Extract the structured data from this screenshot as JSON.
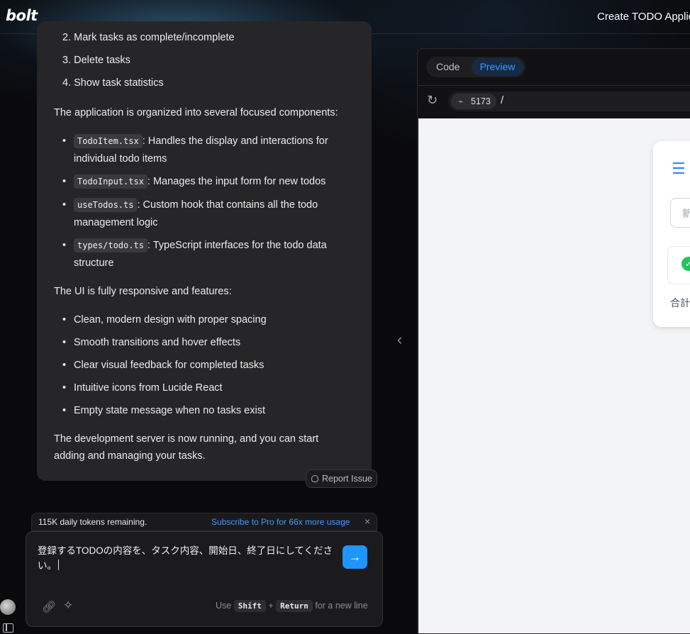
{
  "header": {
    "logo": "bolt",
    "project_title": "Create TODO Applic"
  },
  "message": {
    "ol": [
      {
        "num": "2.",
        "text": "Mark tasks as complete/incomplete"
      },
      {
        "num": "3.",
        "text": "Delete tasks"
      },
      {
        "num": "4.",
        "text": "Show task statistics"
      }
    ],
    "intro": "The application is organized into several focused components:",
    "components": [
      {
        "code": "TodoItem.tsx",
        "text": ": Handles the display and interactions for individual todo items"
      },
      {
        "code": "TodoInput.tsx",
        "text": ": Manages the input form for new todos"
      },
      {
        "code": "useTodos.ts",
        "text": ": Custom hook that contains all the todo management logic"
      },
      {
        "code": "types/todo.ts",
        "text": ": TypeScript interfaces for the todo data structure"
      }
    ],
    "features_intro": "The UI is fully responsive and features:",
    "features": [
      "Clean, modern design with proper spacing",
      "Smooth transitions and hover effects",
      "Clear visual feedback for completed tasks",
      "Intuitive icons from Lucide React",
      "Empty state message when no tasks exist"
    ],
    "closing": "The development server is now running, and you can start adding and managing your tasks.",
    "report_label": "Report Issue"
  },
  "tokens": {
    "remaining": "115K daily tokens remaining.",
    "subscribe": "Subscribe to Pro for 66x more usage",
    "close": "×"
  },
  "input": {
    "value": "登録するTODOの内容を、タスク内容、開始日、終了日にしてください。",
    "hint_use": "Use",
    "hint_shift": "Shift",
    "hint_plus": "+",
    "hint_return": "Return",
    "hint_tail": "for a new line"
  },
  "workbench": {
    "tab_code": "Code",
    "tab_preview": "Preview",
    "port": "5173",
    "path": "/",
    "preview": {
      "input_placeholder": "新",
      "total_label": "合計"
    }
  },
  "icons": {
    "send": "arrow-right-icon",
    "link": "link-icon",
    "sparkles": "sparkles-icon",
    "reload": "reload-icon",
    "plug": "plug-icon",
    "chevron": "chevron-left-icon"
  },
  "colors": {
    "accent": "#1e95ff",
    "link_blue": "#3c9bff",
    "preview_blue": "#3b82f6",
    "check_green": "#22c55e"
  }
}
